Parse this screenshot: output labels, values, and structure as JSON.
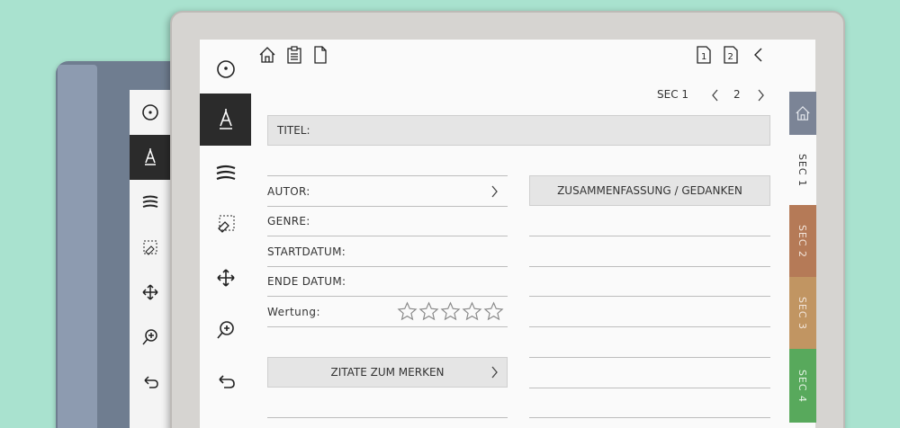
{
  "nav": {
    "section": "SEC 1",
    "page": "2"
  },
  "form": {
    "title_label": "TITEL:",
    "author_label": "AUTOR:",
    "genre_label": "GENRE:",
    "start_label": "STARTDATUM:",
    "end_label": "ENDE DATUM:",
    "rating_label": "Wertung:",
    "rating_value": 0,
    "rating_max": 5,
    "summary_label": "ZUSAMMENFASSUNG / GEDANKEN",
    "quotes_label": "ZITATE ZUM MERKEN"
  },
  "tabs": [
    {
      "label": "SEC 1",
      "color": "#fafafa",
      "text": "#333333"
    },
    {
      "label": "SEC 2",
      "color": "#b57a57",
      "text": "#f3e6dc"
    },
    {
      "label": "SEC 3",
      "color": "#c19562",
      "text": "#f3e6dc"
    },
    {
      "label": "SEC 4",
      "color": "#58a95c",
      "text": "#e6f4e6"
    }
  ],
  "colors": {
    "home_tab": "#7b8496",
    "active_tool": "#2b2b2b"
  },
  "icons": [
    "home-icon",
    "clipboard-icon",
    "page-icon",
    "page-1-icon",
    "page-2-icon",
    "chevron-left-icon",
    "pen-icon",
    "highlighter-icon",
    "eraser-icon",
    "move-icon",
    "zoom-icon",
    "undo-icon"
  ]
}
